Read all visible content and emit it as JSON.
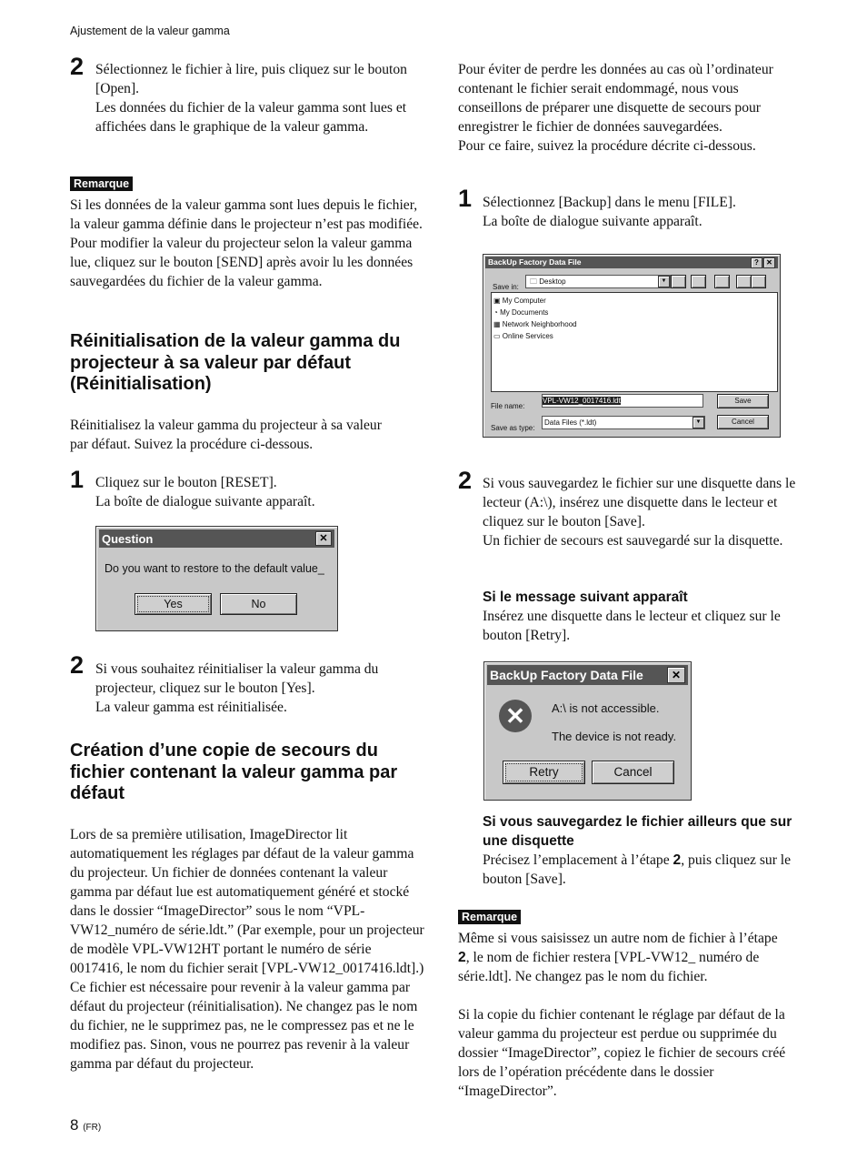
{
  "header": {
    "running_title": "Ajustement de la valeur gamma"
  },
  "left": {
    "step2": {
      "num": "2",
      "lines": [
        "Sélectionnez le fichier à lire, puis cliquez sur le bouton [Open].",
        "Les données du fichier de la valeur gamma sont lues et affichées dans le graphique de la valeur gamma."
      ]
    },
    "remarque1": {
      "label": "Remarque",
      "text": "Si les données de la valeur gamma sont lues depuis le fichier, la valeur gamma définie dans le projecteur n’est pas modifiée. Pour modifier la valeur du projecteur selon la valeur gamma lue, cliquez sur le bouton [SEND] après avoir lu les données sauvegardées du fichier de la valeur gamma."
    },
    "section1": {
      "title": "Réinitialisation de la valeur gamma du projecteur à sa valeur par défaut (Réinitialisation)",
      "intro": "Réinitialisez la valeur gamma du projecteur à sa valeur par défaut. Suivez la procédure ci-dessous.",
      "step1": {
        "num": "1",
        "lines": [
          "Cliquez sur le bouton [RESET].",
          "La boîte de dialogue suivante apparaît."
        ]
      },
      "dialog": {
        "title": "Question",
        "message": "Do you want to restore to the default value_",
        "yes": "Yes",
        "no": "No"
      },
      "step2": {
        "num": "2",
        "lines": [
          "Si vous souhaitez réinitialiser la valeur gamma du projecteur, cliquez sur le bouton [Yes].",
          "La valeur gamma est réinitialisée."
        ]
      }
    },
    "section2": {
      "title": "Création d’une copie de secours du fichier contenant la valeur gamma par défaut",
      "text": "Lors de sa première utilisation, ImageDirector lit automatiquement les réglages par défaut de la valeur gamma du projecteur. Un fichier de données contenant la valeur gamma par défaut lue est automatiquement généré et stocké dans le dossier “ImageDirector” sous le nom “VPL-VW12_numéro de série.ldt.” (Par exemple, pour un projecteur de modèle VPL-VW12HT portant le numéro de série 0017416, le nom du fichier serait [VPL-VW12_0017416.ldt].) Ce fichier est nécessaire pour revenir à la valeur gamma par défaut du projecteur (réinitialisation). Ne changez pas le nom du fichier, ne le supprimez pas, ne le compressez pas et ne le modifiez pas. Sinon, vous ne pourrez pas revenir à la valeur gamma par défaut du projecteur."
    }
  },
  "right": {
    "intro": [
      "Pour éviter de perdre les données au cas où l’ordinateur contenant le fichier serait endommagé, nous vous conseillons de préparer une disquette de secours pour enregistrer le fichier de données sauvegardées.",
      "Pour ce faire, suivez la procédure décrite ci-dessous."
    ],
    "step1": {
      "num": "1",
      "lines": [
        "Sélectionnez [Backup] dans le menu [FILE].",
        "La boîte de dialogue suivante apparaît."
      ]
    },
    "save_dialog": {
      "title": "BackUp Factory Data File",
      "help": "?",
      "save_in_label": "Save in:",
      "save_in_value": "Desktop",
      "items": [
        "My Computer",
        "My Documents",
        "Network Neighborhood",
        "Online Services"
      ],
      "file_name_label": "File name:",
      "file_name_value": "VPL-VW12_0017416.ldt",
      "save_type_label": "Save as type:",
      "save_type_value": "Data Files (*.ldt)",
      "save": "Save",
      "cancel": "Cancel"
    },
    "step2": {
      "num": "2",
      "lines": [
        "Si vous sauvegardez le fichier sur une disquette dans le lecteur (A:\\), insérez une disquette dans le lecteur et cliquez sur le bouton [Save].",
        "Un fichier de secours est sauvegardé sur la disquette."
      ]
    },
    "sub1": {
      "title": "Si le message suivant apparaît",
      "text": "Insérez une disquette dans le lecteur et cliquez sur le bouton [Retry]."
    },
    "error_dialog": {
      "title": "BackUp Factory Data File",
      "line1": "A:\\ is not accessible.",
      "line2": "The device is not ready.",
      "retry": "Retry",
      "cancel": "Cancel"
    },
    "sub2": {
      "title": "Si vous sauvegardez le fichier ailleurs que sur une disquette",
      "text_a": "Précisez l’emplacement à l’étape ",
      "text_bold": "2",
      "text_b": ", puis cliquez sur le bouton [Save]."
    },
    "remarque2": {
      "label": "Remarque",
      "a": "Même si vous saisissez un autre nom de fichier à l’étape ",
      "bold": "2",
      "b": ", le nom de fichier restera [VPL-VW12_ numéro de série.ldt]. Ne changez pas le nom du fichier.",
      "text2": "Si la copie du fichier contenant le réglage par défaut de la valeur gamma du projecteur est perdue ou supprimée du dossier “ImageDirector”, copiez le fichier de secours créé lors de l’opération précédente dans le dossier “ImageDirector”."
    }
  },
  "footer": {
    "page": "8",
    "suffix": "(FR)"
  }
}
